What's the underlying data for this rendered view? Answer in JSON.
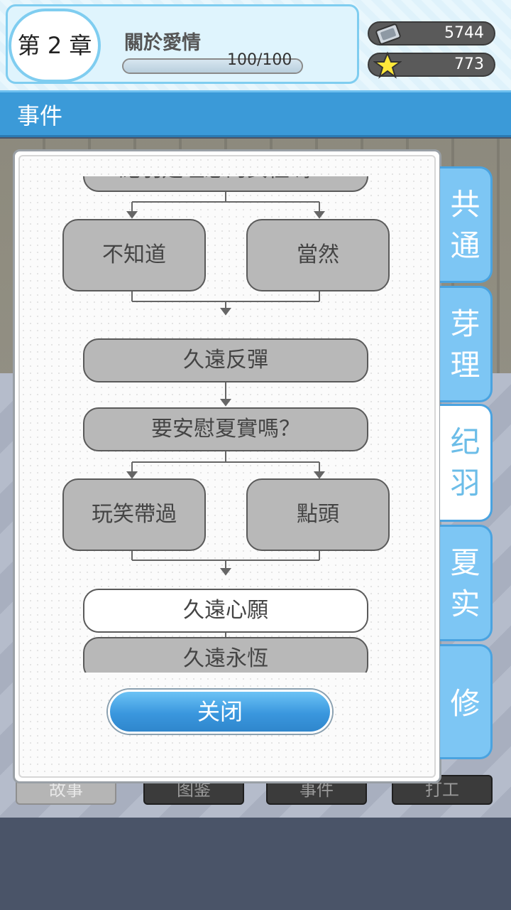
{
  "header": {
    "chapter_label": "第 2 章",
    "chapter_title": "關於愛情",
    "progress_text": "100/100",
    "progress_fraction": 1.0,
    "resources": [
      {
        "icon": "ticket-icon",
        "value": "5744"
      },
      {
        "icon": "star-icon",
        "value": "773"
      }
    ]
  },
  "section": {
    "title": "事件"
  },
  "flow": {
    "top_partial_node": "紀羽是理想的女性嗎？",
    "nodes": [
      {
        "id": "choice-dont-know",
        "label": "不知道",
        "state": "gray"
      },
      {
        "id": "choice-of-course",
        "label": "當然",
        "state": "gray"
      },
      {
        "id": "event-rebound",
        "label": "久遠反彈",
        "state": "gray"
      },
      {
        "id": "question-comfort",
        "label": "要安慰夏實嗎？",
        "state": "gray"
      },
      {
        "id": "choice-laugh-off",
        "label": "玩笑帶過",
        "state": "gray"
      },
      {
        "id": "choice-nod",
        "label": "點頭",
        "state": "gray"
      },
      {
        "id": "event-wish",
        "label": "久遠心願",
        "state": "active"
      },
      {
        "id": "event-eternal",
        "label": "久遠永恆",
        "state": "gray"
      }
    ]
  },
  "close_label": "关闭",
  "side_tabs": [
    {
      "label": "共通",
      "selected": false
    },
    {
      "label": "芽理",
      "selected": false
    },
    {
      "label": "纪羽",
      "selected": true
    },
    {
      "label": "夏实",
      "selected": false
    },
    {
      "label": "修",
      "selected": false
    }
  ],
  "bottom_nav": [
    "故事",
    "图鉴",
    "事件",
    "打工"
  ],
  "colors": {
    "accent": "#3b9ad8",
    "tab": "#7dc6f4",
    "node_gray": "#b8b8b8"
  }
}
